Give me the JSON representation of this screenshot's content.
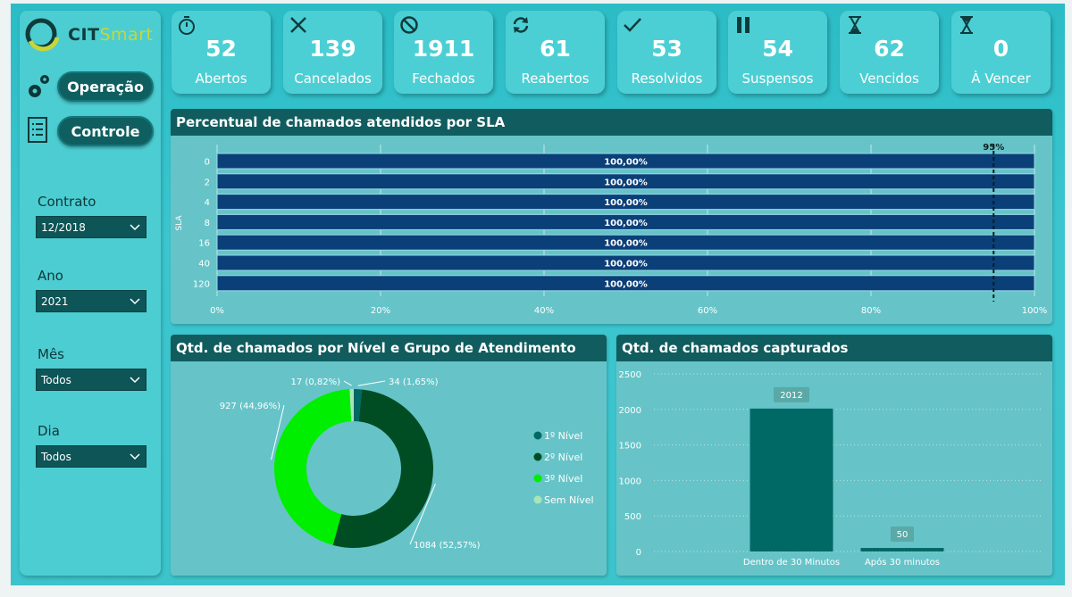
{
  "brand": {
    "cit": "CIT",
    "smart": "Smart"
  },
  "nav": {
    "operacao": "Operação",
    "controle": "Controle"
  },
  "filters": [
    {
      "label": "Contrato",
      "value": "12/2018"
    },
    {
      "label": "Ano",
      "value": "2021"
    },
    {
      "label": "Mês",
      "value": "Todos"
    },
    {
      "label": "Dia",
      "value": "Todos"
    }
  ],
  "kpis": [
    {
      "icon": "stopwatch-icon",
      "value": "52",
      "label": "Abertos"
    },
    {
      "icon": "x-icon",
      "value": "139",
      "label": "Cancelados"
    },
    {
      "icon": "ban-icon",
      "value": "1911",
      "label": "Fechados"
    },
    {
      "icon": "refresh-icon",
      "value": "61",
      "label": "Reabertos"
    },
    {
      "icon": "check-icon",
      "value": "53",
      "label": "Resolvidos"
    },
    {
      "icon": "pause-icon",
      "value": "54",
      "label": "Suspensos"
    },
    {
      "icon": "hourglass-icon",
      "value": "62",
      "label": "Vencidos"
    },
    {
      "icon": "hourglass-icon",
      "value": "0",
      "label": "À Vencer"
    }
  ],
  "colors": {
    "bar_dark": "#0b3f78",
    "teal_dark": "#006966",
    "lime": "#00ee00",
    "mint": "#a8e6b8",
    "green_dark": "#004d24"
  },
  "chart_data": [
    {
      "type": "bar",
      "title": "Percentual de chamados atendidos por SLA",
      "ylabel": "SLA",
      "categories": [
        "0",
        "2",
        "4",
        "8",
        "16",
        "40",
        "120"
      ],
      "values": [
        100,
        100,
        100,
        100,
        100,
        100,
        100
      ],
      "data_labels": [
        "100,00%",
        "100,00%",
        "100,00%",
        "100,00%",
        "100,00%",
        "100,00%",
        "100,00%"
      ],
      "xlim": [
        0,
        100
      ],
      "x_ticks": [
        "0%",
        "20%",
        "40%",
        "60%",
        "80%",
        "100%"
      ],
      "reference_line": {
        "value": 95,
        "label": "95%"
      },
      "orientation": "horizontal"
    },
    {
      "type": "pie",
      "title": "Qtd. de chamados por Nível e Grupo de Atendimento",
      "donut": true,
      "slices": [
        {
          "name": "1º Nível",
          "value": 34,
          "label": "34 (1,65%)",
          "color": "#006966"
        },
        {
          "name": "2º Nível",
          "value": 1084,
          "label": "1084 (52,57%)",
          "color": "#004d24"
        },
        {
          "name": "3º Nível",
          "value": 927,
          "label": "927 (44,96%)",
          "color": "#00ee00"
        },
        {
          "name": "Sem Nível",
          "value": 17,
          "label": "17 (0,82%)",
          "color": "#a8e6b8"
        }
      ],
      "legend_position": "right"
    },
    {
      "type": "bar",
      "title": "Qtd. de chamados capturados",
      "categories": [
        "Dentro de 30 Minutos",
        "Após 30 minutos"
      ],
      "values": [
        2012,
        50
      ],
      "ylim": [
        0,
        2500
      ],
      "y_ticks": [
        "0",
        "500",
        "1000",
        "1500",
        "2000",
        "2500"
      ],
      "grid": true
    }
  ]
}
